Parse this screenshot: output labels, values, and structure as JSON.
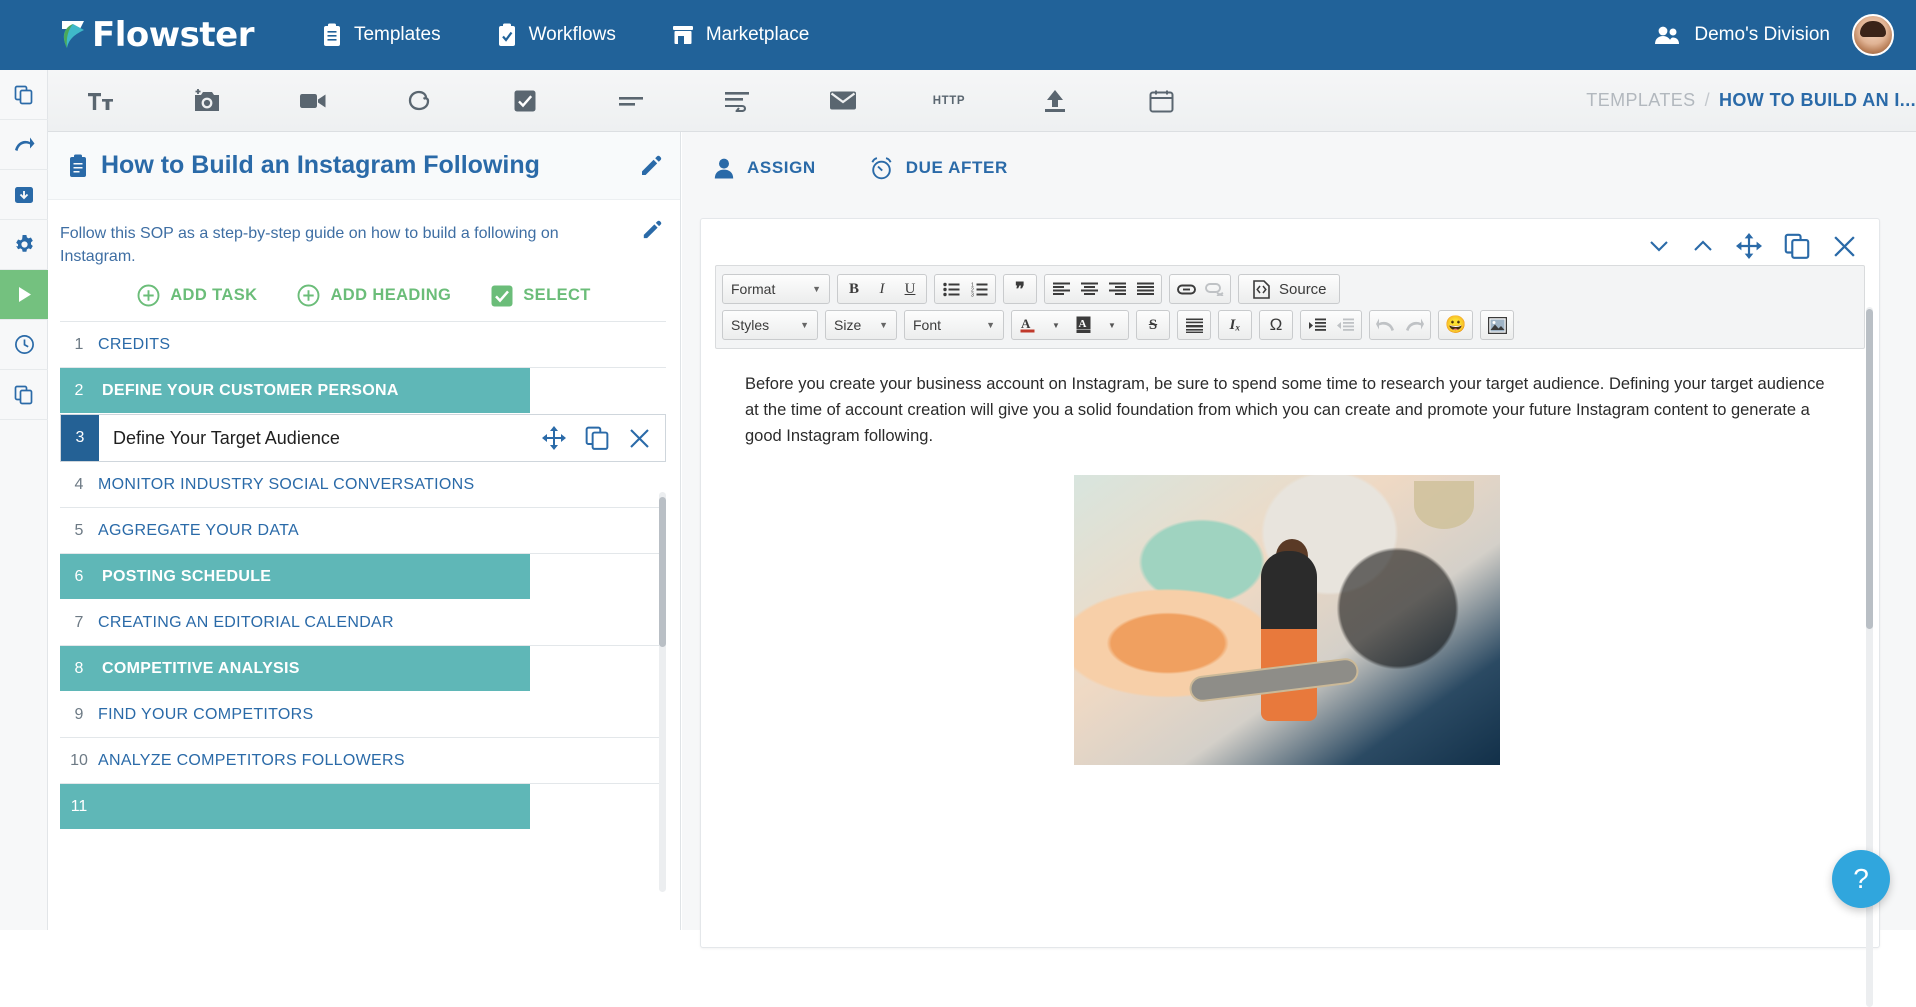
{
  "topnav": {
    "brand": "Flowster",
    "brand_icon": "flowster-logo-icon",
    "items": [
      {
        "label": "Templates",
        "icon": "clipboard-icon"
      },
      {
        "label": "Workflows",
        "icon": "clipboard-check-icon"
      },
      {
        "label": "Marketplace",
        "icon": "store-icon"
      }
    ],
    "division": {
      "label": "Demo's Division",
      "icon": "people-icon"
    },
    "avatar": "user-avatar",
    "bg_color": "#216299"
  },
  "rail": {
    "items": [
      {
        "name": "copy-icon",
        "active": false
      },
      {
        "name": "redo-arrow-icon",
        "active": false
      },
      {
        "name": "archive-download-icon",
        "active": false
      },
      {
        "name": "gear-icon",
        "active": false
      },
      {
        "name": "play-icon",
        "active": true
      },
      {
        "name": "history-clock-icon",
        "active": false
      },
      {
        "name": "duplicate-icon",
        "active": false
      }
    ],
    "active_color": "#74c17f"
  },
  "toolbar": {
    "buttons": [
      {
        "icon": "text-format-icon",
        "glyph": "Tт"
      },
      {
        "icon": "add-photo-icon"
      },
      {
        "icon": "video-camera-icon"
      },
      {
        "icon": "attachment-icon"
      },
      {
        "icon": "checkbox-icon"
      },
      {
        "icon": "short-text-icon"
      },
      {
        "icon": "long-text-icon"
      },
      {
        "icon": "email-icon"
      },
      {
        "icon": "http-icon",
        "glyph": "HTTP"
      },
      {
        "icon": "upload-icon"
      },
      {
        "icon": "calendar-icon"
      }
    ],
    "breadcrumb": {
      "parent": "TEMPLATES",
      "separator": "/",
      "current": "HOW TO BUILD AN I..."
    }
  },
  "left_panel": {
    "title": "How to Build an Instagram Following",
    "title_icon": "clipboard-icon",
    "edit_icon": "pencil-icon",
    "description": "Follow this SOP as a step-by-step guide on how to build a following on Instagram.",
    "actions": [
      {
        "label": "ADD TASK",
        "icon": "plus-circle-icon"
      },
      {
        "label": "ADD HEADING",
        "icon": "plus-circle-icon"
      },
      {
        "label": "SELECT",
        "icon": "checkbox-checked-icon"
      }
    ],
    "action_color": "#6bbd79",
    "heading_color": "#5fb7b7",
    "tasks": [
      {
        "num": "1",
        "label": "CREDITS",
        "type": "task"
      },
      {
        "num": "2",
        "label": "DEFINE YOUR CUSTOMER PERSONA",
        "type": "heading"
      },
      {
        "num": "3",
        "label": "Define Your Target Audience",
        "type": "editing"
      },
      {
        "num": "4",
        "label": "MONITOR INDUSTRY SOCIAL CONVERSATIONS",
        "type": "task"
      },
      {
        "num": "5",
        "label": "AGGREGATE YOUR DATA",
        "type": "task"
      },
      {
        "num": "6",
        "label": "POSTING SCHEDULE",
        "type": "heading"
      },
      {
        "num": "7",
        "label": "CREATING AN EDITORIAL CALENDAR",
        "type": "task"
      },
      {
        "num": "8",
        "label": "COMPETITIVE ANALYSIS",
        "type": "heading"
      },
      {
        "num": "9",
        "label": "FIND YOUR COMPETITORS",
        "type": "task"
      },
      {
        "num": "10",
        "label": "ANALYZE COMPETITORS FOLLOWERS",
        "type": "task"
      },
      {
        "num": "11",
        "label": "",
        "type": "heading"
      }
    ],
    "row_tools": [
      {
        "icon": "move-icon"
      },
      {
        "icon": "duplicate-icon"
      },
      {
        "icon": "close-icon"
      }
    ]
  },
  "right_panel": {
    "chips": [
      {
        "label": "ASSIGN",
        "icon": "person-icon"
      },
      {
        "label": "DUE AFTER",
        "icon": "alarm-clock-icon"
      }
    ],
    "card_tools": [
      {
        "icon": "chevron-down-icon"
      },
      {
        "icon": "chevron-up-icon"
      },
      {
        "icon": "move-icon"
      },
      {
        "icon": "duplicate-icon"
      },
      {
        "icon": "close-icon"
      }
    ],
    "editor": {
      "toolbar_row1": {
        "format_combo": "Format",
        "groups": [
          {
            "buttons": [
              {
                "icon": "bold-icon",
                "glyph": "B"
              },
              {
                "icon": "italic-icon",
                "glyph": "I"
              },
              {
                "icon": "underline-icon",
                "glyph": "U"
              }
            ]
          },
          {
            "buttons": [
              {
                "icon": "bulleted-list-icon"
              },
              {
                "icon": "numbered-list-icon"
              }
            ]
          },
          {
            "buttons": [
              {
                "icon": "blockquote-icon",
                "glyph": "❞"
              }
            ]
          },
          {
            "buttons": [
              {
                "icon": "align-left-icon"
              },
              {
                "icon": "align-center-icon"
              },
              {
                "icon": "align-right-icon"
              },
              {
                "icon": "align-justify-icon"
              }
            ]
          },
          {
            "buttons": [
              {
                "icon": "link-icon"
              },
              {
                "icon": "unlink-icon"
              }
            ]
          },
          {
            "buttons": [
              {
                "icon": "source-icon",
                "glyph": "Source"
              }
            ]
          }
        ]
      },
      "toolbar_row2": {
        "styles_combo": "Styles",
        "size_combo": "Size",
        "font_combo": "Font",
        "groups": [
          {
            "buttons": [
              {
                "icon": "text-color-icon",
                "glyph": "A"
              },
              {
                "icon": "background-color-icon",
                "glyph": "A"
              }
            ]
          },
          {
            "buttons": [
              {
                "icon": "strikethrough-icon",
                "glyph": "S"
              }
            ]
          },
          {
            "buttons": [
              {
                "icon": "horizontal-rule-icon"
              }
            ]
          },
          {
            "buttons": [
              {
                "icon": "remove-format-icon",
                "glyph": "Iₓ"
              }
            ]
          },
          {
            "buttons": [
              {
                "icon": "special-character-icon",
                "glyph": "Ω"
              }
            ]
          },
          {
            "buttons": [
              {
                "icon": "increase-indent-icon"
              },
              {
                "icon": "decrease-indent-icon"
              }
            ]
          },
          {
            "buttons": [
              {
                "icon": "undo-icon"
              },
              {
                "icon": "redo-icon"
              }
            ]
          },
          {
            "buttons": [
              {
                "icon": "emoji-icon",
                "glyph": "😀"
              }
            ]
          },
          {
            "buttons": [
              {
                "icon": "insert-image-icon"
              }
            ]
          }
        ]
      },
      "paragraphs": [
        "Before you create your business account on Instagram, be sure to spend some time to research your target audience. Defining your target audience at the time of account creation will give you a solid foundation from which you can create and promote your future Instagram content to generate a good Instagram following."
      ],
      "image_alt": "woman-with-skateboard-graffiti-wall-photo"
    }
  },
  "help": {
    "icon": "question-mark-icon",
    "glyph": "?",
    "color": "#30a6dd"
  }
}
